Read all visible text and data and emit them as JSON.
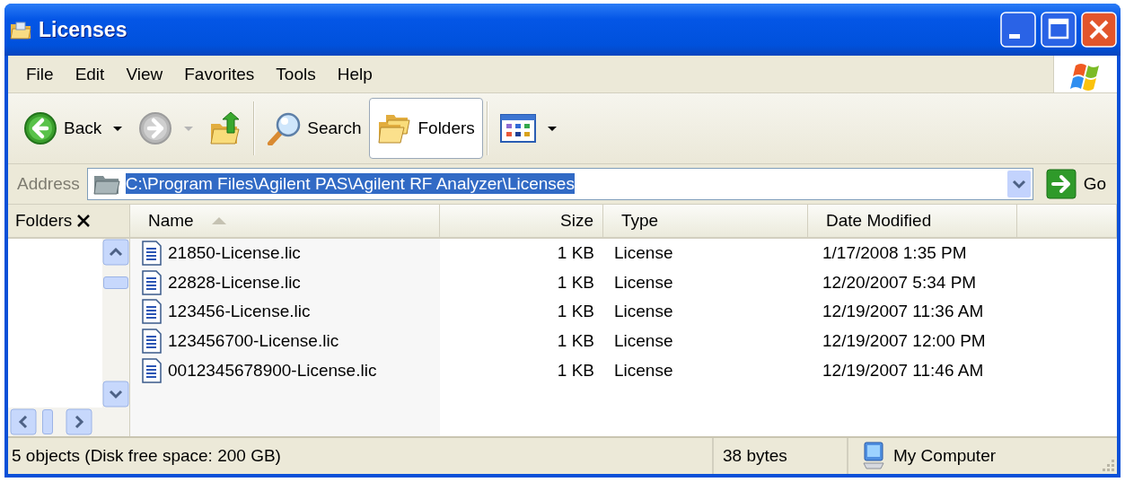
{
  "window": {
    "title": "Licenses"
  },
  "menu": [
    {
      "label": "File"
    },
    {
      "label": "Edit"
    },
    {
      "label": "View"
    },
    {
      "label": "Favorites"
    },
    {
      "label": "Tools"
    },
    {
      "label": "Help"
    }
  ],
  "toolbar": [
    {
      "kind": "back",
      "label": "Back",
      "disabled": false,
      "selected": false
    },
    {
      "kind": "forward",
      "disabled": true,
      "selected": false
    },
    {
      "kind": "up",
      "disabled": false,
      "selected": false
    },
    {
      "kind": "search",
      "label": "Search",
      "disabled": false,
      "selected": false
    },
    {
      "kind": "folders",
      "label": "Folders",
      "disabled": false,
      "selected": true
    },
    {
      "kind": "views",
      "disabled": false,
      "selected": false
    }
  ],
  "address": {
    "label": "Address",
    "value": "C:\\Program Files\\Agilent PAS\\Agilent RF Analyzer\\Licenses",
    "selected": true,
    "go": "Go"
  },
  "folders_pane": {
    "title": "Folders"
  },
  "columns": [
    {
      "label": "Name",
      "sorted": true
    },
    {
      "label": "Size",
      "sorted": false
    },
    {
      "label": "Type",
      "sorted": false
    },
    {
      "label": "Date Modified",
      "sorted": false
    }
  ],
  "rows": [
    {
      "name": "21850-License.lic",
      "size": "1 KB",
      "type": "License",
      "date": "1/17/2008 1:35 PM"
    },
    {
      "name": "22828-License.lic",
      "size": "1 KB",
      "type": "License",
      "date": "12/20/2007 5:34 PM"
    },
    {
      "name": "123456-License.lic",
      "size": "1 KB",
      "type": "License",
      "date": "12/19/2007 11:36 AM"
    },
    {
      "name": "123456700-License.lic",
      "size": "1 KB",
      "type": "License",
      "date": "12/19/2007 12:00 PM"
    },
    {
      "name": "0012345678900-License.lic",
      "size": "1 KB",
      "type": "License",
      "date": "12/19/2007 11:46 AM"
    }
  ],
  "status_bar": {
    "summary": "5 objects (Disk free space: 200 GB)",
    "size": "38 bytes",
    "zone": "My Computer"
  }
}
